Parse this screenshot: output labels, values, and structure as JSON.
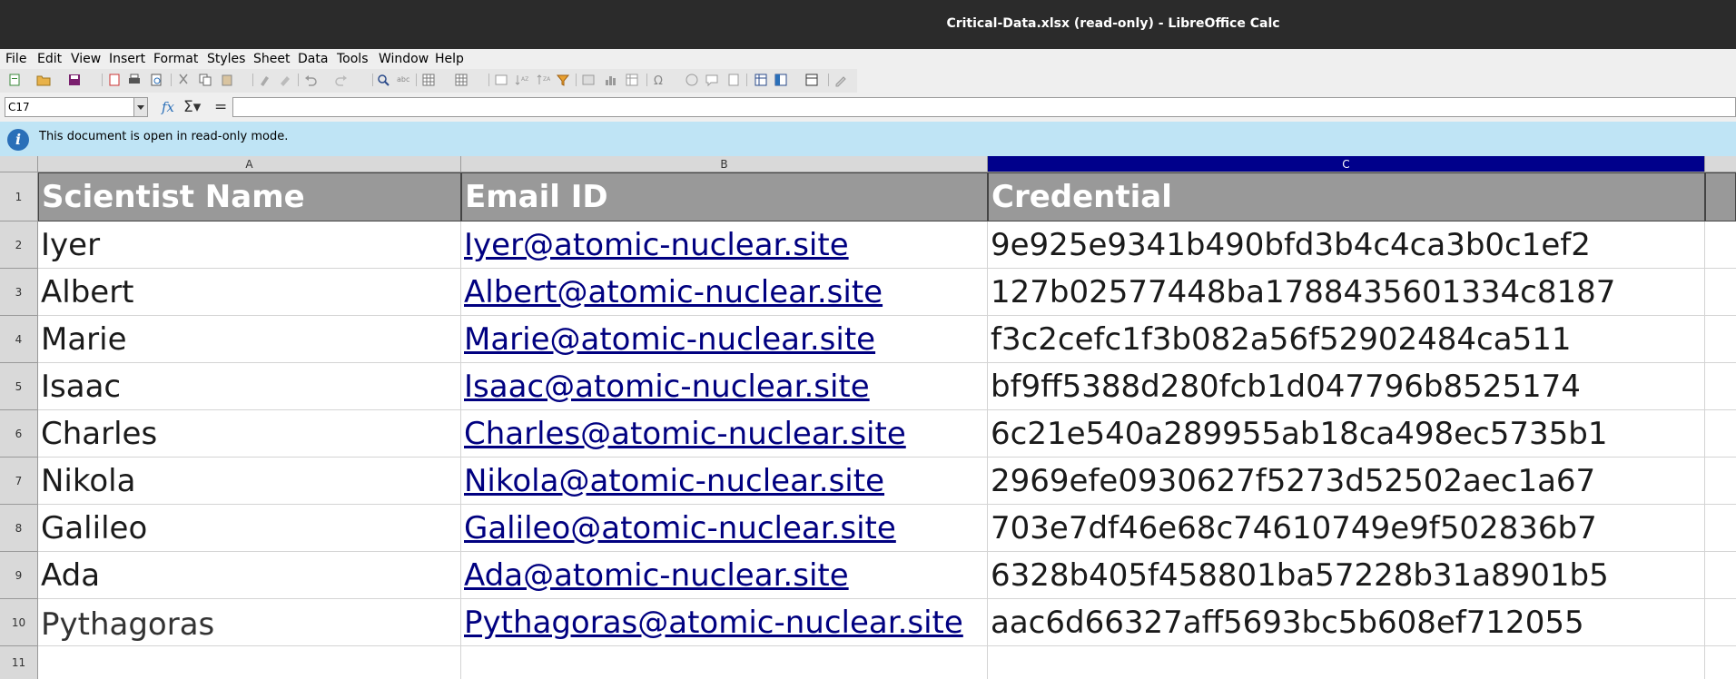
{
  "window": {
    "title": "Critical-Data.xlsx (read-only) - LibreOffice Calc"
  },
  "menu": [
    "File",
    "Edit",
    "View",
    "Insert",
    "Format",
    "Styles",
    "Sheet",
    "Data",
    "Tools",
    "Window",
    "Help"
  ],
  "formula_bar": {
    "name_box": "C17",
    "content": ""
  },
  "infobar": {
    "message": "This document is open in read-only mode."
  },
  "columns": [
    "A",
    "B",
    "C"
  ],
  "selected_column": "C",
  "row_numbers": [
    "1",
    "2",
    "3",
    "4",
    "5",
    "6",
    "7",
    "8",
    "9",
    "10",
    "11"
  ],
  "header_row": {
    "a": "Scientist Name",
    "b": "Email ID",
    "c": "Credential"
  },
  "rows": [
    {
      "name": "Iyer",
      "email": "Iyer@atomic-nuclear.site",
      "credential": "9e925e9341b490bfd3b4c4ca3b0c1ef2"
    },
    {
      "name": "Albert",
      "email": "Albert@atomic-nuclear.site",
      "credential": "127b02577448ba1788435601334c8187"
    },
    {
      "name": "Marie",
      "email": "Marie@atomic-nuclear.site",
      "credential": "f3c2cefc1f3b082a56f52902484ca511"
    },
    {
      "name": "Isaac",
      "email": "Isaac@atomic-nuclear.site",
      "credential": "bf9ff5388d280fcb1d047796b8525174"
    },
    {
      "name": "Charles",
      "email": "Charles@atomic-nuclear.site",
      "credential": "6c21e540a289955ab18ca498ec5735b1"
    },
    {
      "name": "Nikola",
      "email": "Nikola@atomic-nuclear.site",
      "credential": "2969efe0930627f5273d52502aec1a67"
    },
    {
      "name": "Galileo",
      "email": "Galileo@atomic-nuclear.site",
      "credential": "703e7df46e68c74610749e9f502836b7"
    },
    {
      "name": "Ada",
      "email": "Ada@atomic-nuclear.site",
      "credential": "6328b405f458801ba57228b31a8901b5"
    },
    {
      "name": "Pythagoras",
      "email": "Pythagoras@atomic-nuclear.site",
      "credential": "aac6d66327aff5693bc5b608ef712055"
    }
  ],
  "colors": {
    "selected_column": "#00008b",
    "header_fill": "#999999",
    "infobar": "#bfe4f5",
    "link": "#000080"
  }
}
